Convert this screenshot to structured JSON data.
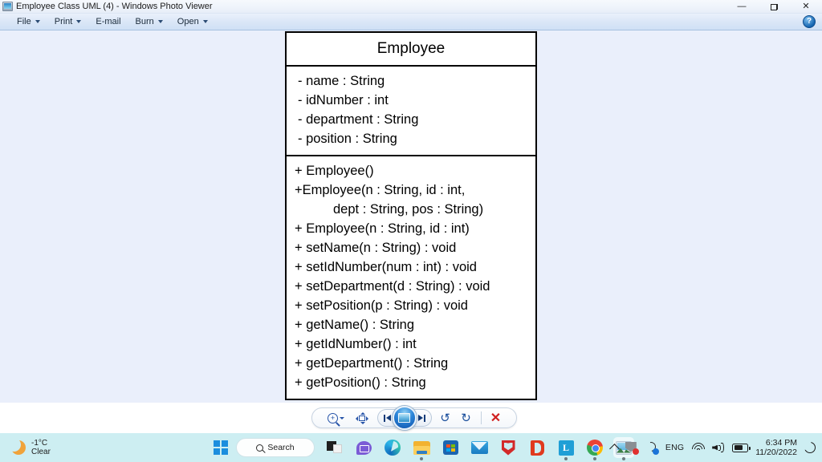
{
  "window": {
    "title": "Employee Class UML (4) - Windows Photo Viewer",
    "app_icon": "photo-viewer-icon",
    "controls": {
      "minimize": "—",
      "restore": "restore-icon",
      "close": "✕"
    }
  },
  "menubar": {
    "items": [
      {
        "label": "File",
        "has_caret": true
      },
      {
        "label": "Print",
        "has_caret": true
      },
      {
        "label": "E-mail",
        "has_caret": false
      },
      {
        "label": "Burn",
        "has_caret": true
      },
      {
        "label": "Open",
        "has_caret": true
      }
    ],
    "help_label": "?"
  },
  "uml": {
    "class_name": "Employee",
    "attributes": [
      "- name : String",
      "- idNumber : int",
      "- department : String",
      "- position : String"
    ],
    "methods": [
      {
        "text": "+ Employee()",
        "indent": false
      },
      {
        "text": "+Employee(n : String, id : int,",
        "indent": false
      },
      {
        "text": "dept : String, pos : String)",
        "indent": true
      },
      {
        "text": "+ Employee(n : String, id : int)",
        "indent": false
      },
      {
        "text": "+ setName(n : String) : void",
        "indent": false
      },
      {
        "text": "+ setIdNumber(num : int) : void",
        "indent": false
      },
      {
        "text": "+ setDepartment(d : String) : void",
        "indent": false
      },
      {
        "text": "+ setPosition(p : String) : void",
        "indent": false
      },
      {
        "text": "+ getName() : String",
        "indent": false
      },
      {
        "text": "+ getIdNumber() : int",
        "indent": false
      },
      {
        "text": "+ getDepartment() : String",
        "indent": false
      },
      {
        "text": "+ getPosition() : String",
        "indent": false
      }
    ],
    "border_color": "#000000",
    "background": "#ffffff"
  },
  "viewer_toolbar": {
    "zoom": "zoom-icon",
    "fit_to_window": "fit-to-window-icon",
    "previous": "previous-icon",
    "slideshow": "slideshow-icon",
    "next": "next-icon",
    "rotate_ccw": "↺",
    "rotate_cw": "↻",
    "delete": "✕"
  },
  "taskbar": {
    "weather": {
      "temperature": "-1°C",
      "condition": "Clear",
      "icon": "moon-icon"
    },
    "search": {
      "label": "Search",
      "icon": "search-icon"
    },
    "start": "windows-logo-icon",
    "apps": [
      {
        "name": "task-view",
        "running": false
      },
      {
        "name": "chat",
        "running": false
      },
      {
        "name": "microsoft-edge",
        "running": false
      },
      {
        "name": "file-explorer",
        "running": true
      },
      {
        "name": "microsoft-store",
        "running": false
      },
      {
        "name": "mail",
        "running": false
      },
      {
        "name": "mcafee",
        "running": false
      },
      {
        "name": "microsoft-office",
        "running": false
      },
      {
        "name": "libreoffice",
        "running": true
      },
      {
        "name": "google-chrome",
        "running": true
      },
      {
        "name": "windows-photo-viewer",
        "running": true,
        "active": true
      }
    ],
    "tray": {
      "show_hidden": "chevron-up-icon",
      "mcafee_alert": "!",
      "sync": "sync-icon",
      "language": "ENG",
      "wifi": "wifi-icon",
      "volume": "volume-icon",
      "battery": "battery-icon",
      "time": "6:34 PM",
      "date": "11/20/2022",
      "do_not_disturb": "moon-icon"
    }
  },
  "colors": {
    "canvas_background": "#eaeffb",
    "taskbar_background": "#cdeef2",
    "accent": "#1b8ede",
    "toolbar_strip": "#ffffff"
  }
}
